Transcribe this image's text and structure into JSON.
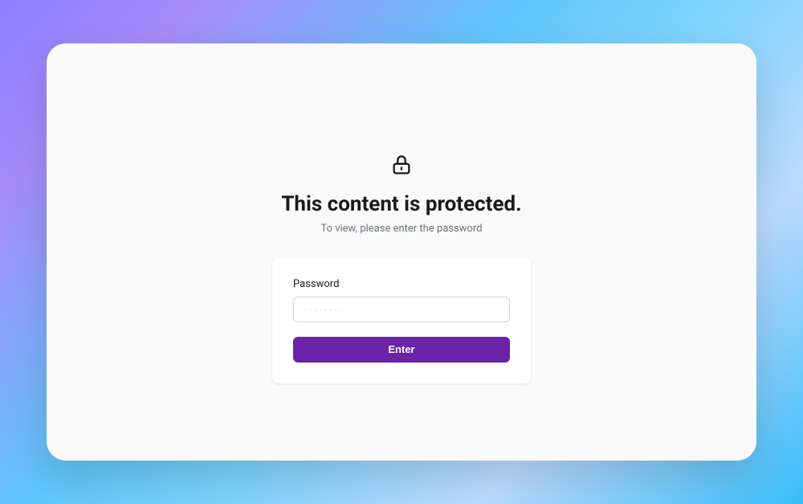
{
  "heading": {
    "title": "This content is protected.",
    "subtitle": "To view, please enter the password"
  },
  "form": {
    "password_label": "Password",
    "password_placeholder": "········",
    "submit_label": "Enter"
  }
}
